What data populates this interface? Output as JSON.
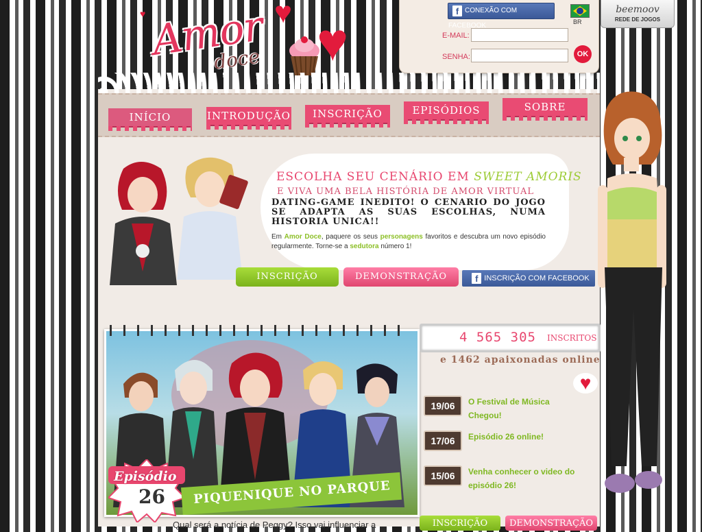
{
  "header": {
    "logo_main": "Amor",
    "logo_sub": "doce",
    "facebook_connect": "CONEXÃO COM FACEBOOK",
    "email_label": "E-MAIL:",
    "password_label": "SENHA:",
    "ok_label": "OK",
    "country_code": "BR",
    "network_name": "beemoov",
    "network_label": "REDE DE JOGOS"
  },
  "nav": {
    "tabs": [
      {
        "label": "INÍCIO"
      },
      {
        "label": "INTRODUÇÃO"
      },
      {
        "label": "INSCRIÇÃO"
      },
      {
        "label": "EPISÓDIOS"
      },
      {
        "label": "SOBRE"
      }
    ]
  },
  "hero": {
    "title_prefix": "ESCOLHA SEU CENÁRIO EM",
    "title_accent": "SWEET AMORIS",
    "subtitle": "E VIVA UMA BELA HISTÓRIA DE AMOR VIRTUAL",
    "tagline": "DATING-GAME INEDITO! O CENARIO DO JOGO SE ADAPTA AS SUAS ESCOLHAS, NUMA HISTORIA UNICA!!",
    "desc_1": "Em",
    "desc_brand": "Amor Doce",
    "desc_2": ", paquere os seus",
    "desc_chars": "personagens",
    "desc_3": "favoritos e descubra um novo episódio regularmente. Torne-se a",
    "desc_seductor": "sedutora",
    "desc_4": "número 1!",
    "cta_register": "INSCRIÇÃO",
    "cta_demo": "DEMONSTRAÇÃO",
    "cta_facebook": "INSCRIÇÃO COM FACEBOOK"
  },
  "episode": {
    "badge_label": "Episódio",
    "number": "26",
    "title": "PIQUENIQUE NO PARQUE",
    "teaser": "Qual será a notícia de Peggy? Isso vai influenciar a"
  },
  "stats": {
    "registered_count": "4 565 305",
    "registered_label": "INSCRITOS",
    "online_text": "e 1462 apaixonadas online"
  },
  "news": [
    {
      "date": "19/06",
      "text": "O Festival de Música Chegou!"
    },
    {
      "date": "17/06",
      "text": "Episódio 26 online!"
    },
    {
      "date": "15/06",
      "text": "Venha conhecer o video do episódio 26!"
    }
  ],
  "side_buttons": {
    "register": "INSCRIÇÃO",
    "demo": "DEMONSTRAÇÃO"
  },
  "colors": {
    "brand_pink": "#e8466e",
    "brand_green": "#8cc53a",
    "facebook_blue": "#3b5998",
    "news_date_bg": "#4e3a30"
  },
  "icons": [
    "heart-icon",
    "cupcake-icon",
    "facebook-icon",
    "brazil-flag-icon"
  ]
}
